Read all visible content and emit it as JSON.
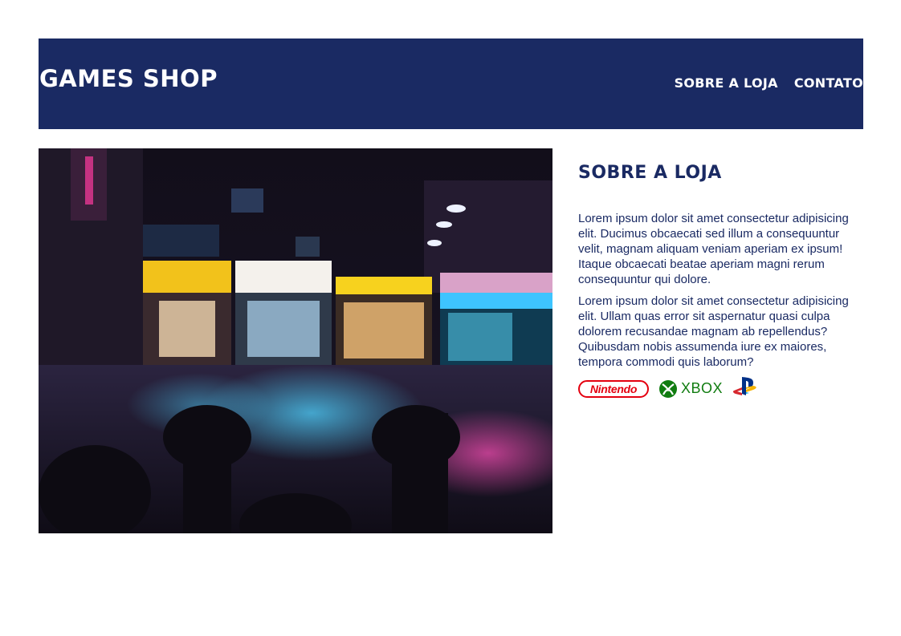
{
  "header": {
    "logo": "GAMES SHOP",
    "nav": [
      "SOBRE A LOJA",
      "CONTATO"
    ]
  },
  "hero": {
    "image": "night street market with neon shop signs and parked motorbikes"
  },
  "about": {
    "title": "SOBRE A LOJA",
    "paragraphs": [
      "Lorem ipsum dolor sit amet consectetur adipisicing elit. Ducimus obcaecati sed illum a consequuntur velit, magnam aliquam veniam aperiam ex ipsum! Itaque obcaecati beatae aperiam magni rerum consequuntur qui dolore.",
      "Lorem ipsum dolor sit amet consectetur adipisicing elit. Ullam quas error sit aspernatur quasi culpa dolorem recusandae magnam ab repellendus? Quibusdam nobis assumenda iure ex maiores, tempora commodi quis laborum?"
    ],
    "brands": {
      "nintendo": "Nintendo",
      "xbox": "XBOX",
      "playstation_icon": "playstation-icon"
    }
  },
  "colors": {
    "primary": "#1a2a63",
    "nintendo_red": "#e4000f",
    "xbox_green": "#107c10"
  }
}
